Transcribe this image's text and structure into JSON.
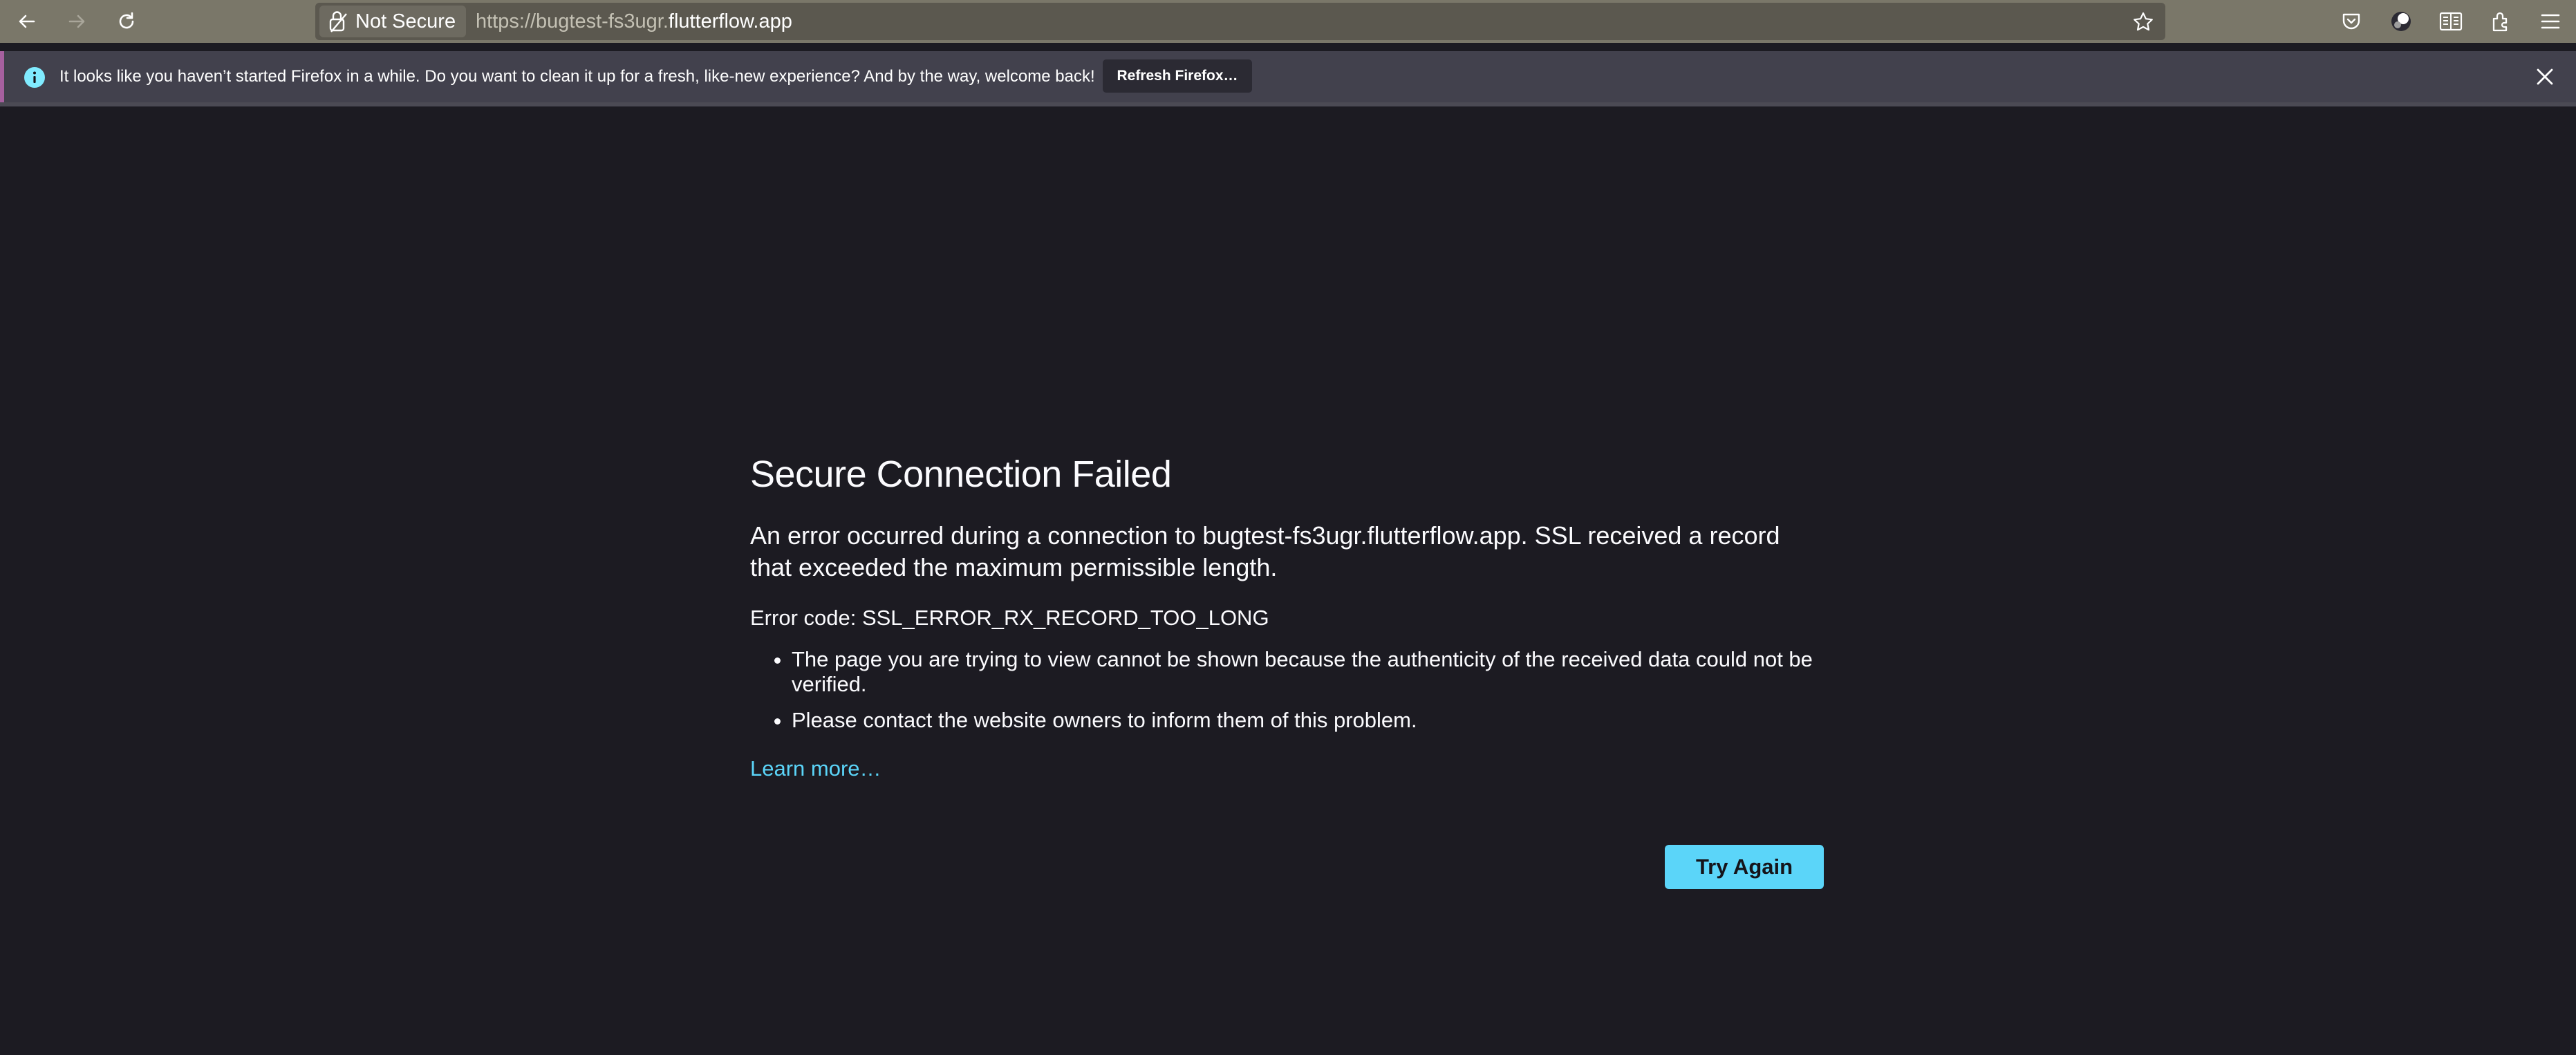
{
  "browser": {
    "security_label": "Not Secure",
    "url_prefix": "https://bugtest-fs3ugr.",
    "url_host": "flutterflow.app",
    "icons": [
      "back-icon",
      "forward-icon",
      "reload-icon",
      "lock-icon",
      "bookmark-star-icon",
      "pocket-icon",
      "account-avatar-icon",
      "reader-view-icon",
      "extensions-icon",
      "menu-icon"
    ]
  },
  "infobar": {
    "message": "It looks like you haven’t started Firefox in a while. Do you want to clean it up for a fresh, like-new experience? And by the way, welcome back!",
    "button_label": "Refresh Firefox…"
  },
  "error": {
    "title": "Secure Connection Failed",
    "description": "An error occurred during a connection to bugtest-fs3ugr.flutterflow.app. SSL received a record that exceeded the maximum permissible length.",
    "code_line": "Error code: SSL_ERROR_RX_RECORD_TOO_LONG",
    "bullets": [
      "The page you are trying to view cannot be shown because the authenticity of the received data could not be verified.",
      "Please contact the website owners to inform them of this problem."
    ],
    "learn_more": "Learn more…",
    "try_again": "Try Again"
  },
  "colors": {
    "page_background": "#1c1b22",
    "toolbar": "#7a7769",
    "accent": "#5bd5f9",
    "infobar": "#42414d"
  }
}
